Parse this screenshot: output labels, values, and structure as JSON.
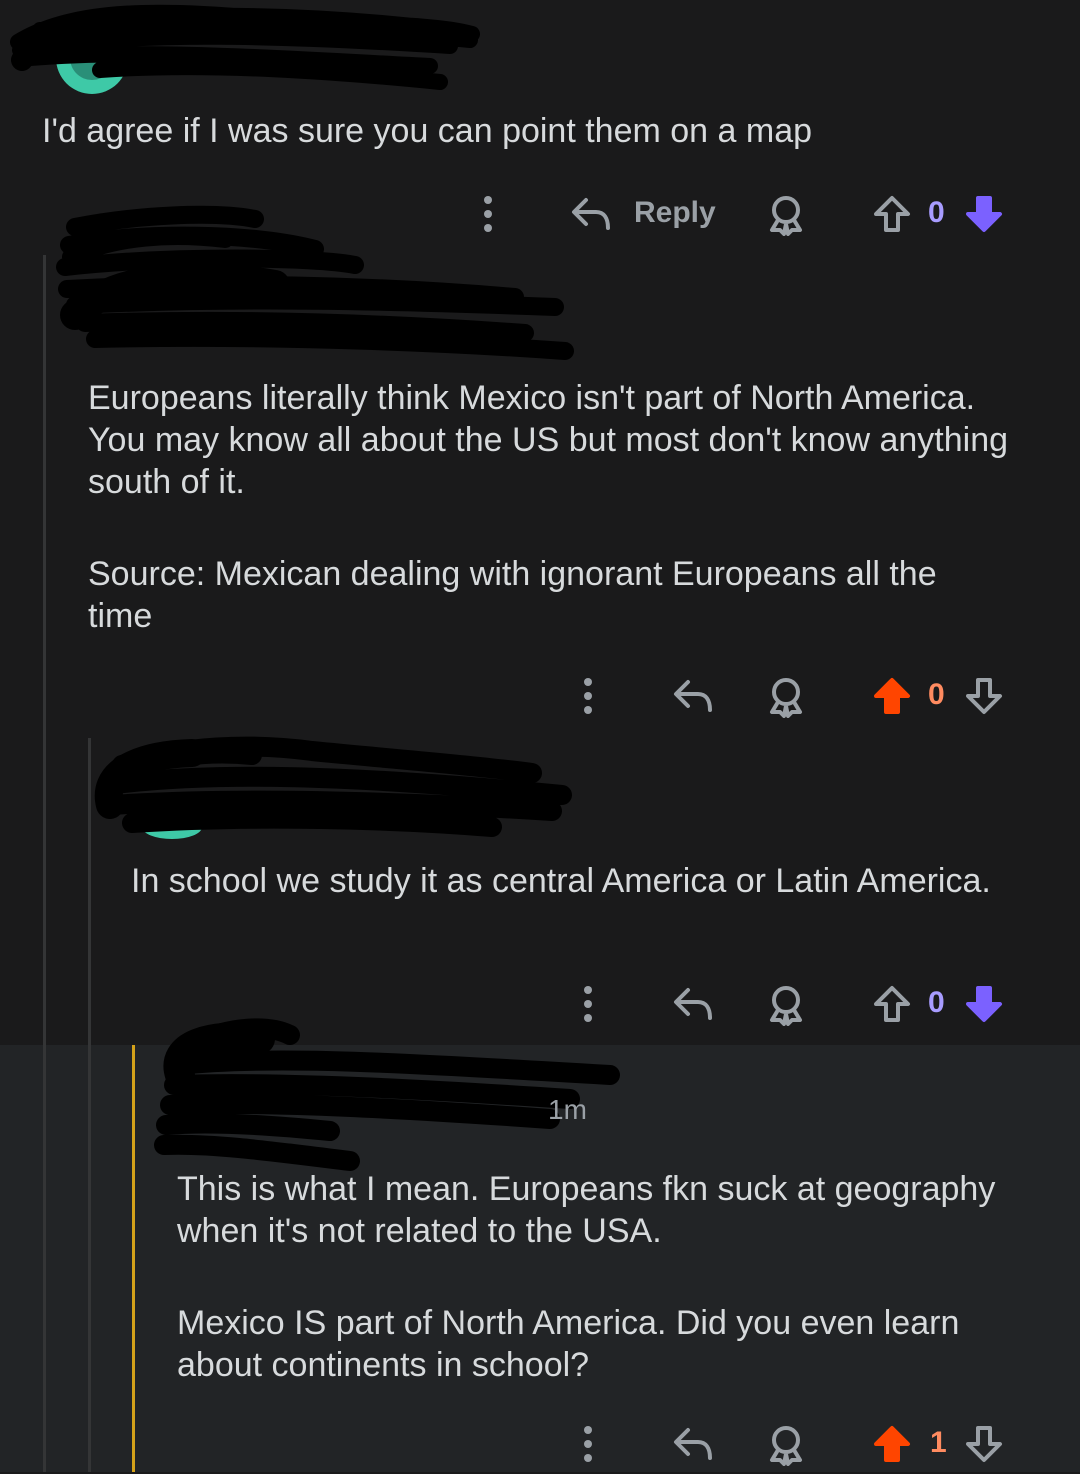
{
  "colors": {
    "background": "#1a1a1b",
    "highlight_background": "#222426",
    "text": "#d7dadc",
    "muted": "#9aa0a6",
    "upvote_active": "#ff4500",
    "downvote_active": "#7b61ff",
    "score_upvoted": "#ff8b60",
    "score_downvoted": "#a89cff",
    "highlight_rail": "#d4a21a",
    "thread_line": "#343536",
    "avatar_teal": "#3ec9a7"
  },
  "comments": [
    {
      "id": "c1",
      "username_hidden": true,
      "body": [
        "I'd agree if I was sure you can point them on a map"
      ],
      "actions": {
        "reply_label": "Reply",
        "score": "0",
        "vote": "down"
      }
    },
    {
      "id": "c2",
      "username_hidden": true,
      "body": [
        "Europeans literally think Mexico isn't part of North America. You may know all about the US but most don't know anything south of it.",
        "Source: Mexican dealing with ignorant Europeans all the time"
      ],
      "actions": {
        "score": "0",
        "vote": "up"
      }
    },
    {
      "id": "c3",
      "username_hidden": true,
      "body": [
        "In school we study it as central America or Latin America."
      ],
      "actions": {
        "score": "0",
        "vote": "down"
      }
    },
    {
      "id": "c4",
      "username_hidden": true,
      "timestamp": "1m",
      "highlighted": true,
      "body": [
        "This is what I mean. Europeans fkn suck at geography when it's not related to the USA.",
        "Mexico IS part of North America. Did you even learn about continents in school?"
      ],
      "actions": {
        "score": "1",
        "vote": "up"
      }
    }
  ],
  "icons": {
    "more": "more-vertical-icon",
    "reply": "reply-arrow-icon",
    "award": "award-icon",
    "upvote": "upvote-arrow-icon",
    "downvote": "downvote-arrow-icon"
  }
}
